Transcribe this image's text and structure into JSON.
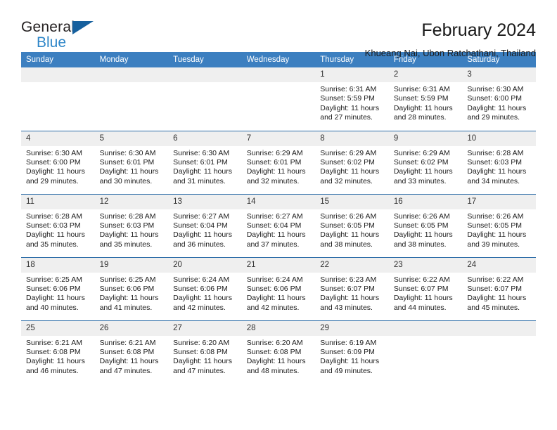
{
  "logo": {
    "word_top": "General",
    "word_bottom": "Blue",
    "triangle_color": "#16609E",
    "blue_color": "#2E86C8"
  },
  "header": {
    "title": "February 2024",
    "subtitle": "Khueang Nai, Ubon Ratchathani, Thailand"
  },
  "theme": {
    "header_blue": "#3C7FC0",
    "row_border_blue": "#2E6DA8",
    "daynum_gray": "#EFEFEF"
  },
  "weekdays": [
    "Sunday",
    "Monday",
    "Tuesday",
    "Wednesday",
    "Thursday",
    "Friday",
    "Saturday"
  ],
  "weeks": [
    [
      {
        "day": "",
        "lines": []
      },
      {
        "day": "",
        "lines": []
      },
      {
        "day": "",
        "lines": []
      },
      {
        "day": "",
        "lines": []
      },
      {
        "day": "1",
        "lines": [
          "Sunrise: 6:31 AM",
          "Sunset: 5:59 PM",
          "Daylight: 11 hours",
          "and 27 minutes."
        ]
      },
      {
        "day": "2",
        "lines": [
          "Sunrise: 6:31 AM",
          "Sunset: 5:59 PM",
          "Daylight: 11 hours",
          "and 28 minutes."
        ]
      },
      {
        "day": "3",
        "lines": [
          "Sunrise: 6:30 AM",
          "Sunset: 6:00 PM",
          "Daylight: 11 hours",
          "and 29 minutes."
        ]
      }
    ],
    [
      {
        "day": "4",
        "lines": [
          "Sunrise: 6:30 AM",
          "Sunset: 6:00 PM",
          "Daylight: 11 hours",
          "and 29 minutes."
        ]
      },
      {
        "day": "5",
        "lines": [
          "Sunrise: 6:30 AM",
          "Sunset: 6:01 PM",
          "Daylight: 11 hours",
          "and 30 minutes."
        ]
      },
      {
        "day": "6",
        "lines": [
          "Sunrise: 6:30 AM",
          "Sunset: 6:01 PM",
          "Daylight: 11 hours",
          "and 31 minutes."
        ]
      },
      {
        "day": "7",
        "lines": [
          "Sunrise: 6:29 AM",
          "Sunset: 6:01 PM",
          "Daylight: 11 hours",
          "and 32 minutes."
        ]
      },
      {
        "day": "8",
        "lines": [
          "Sunrise: 6:29 AM",
          "Sunset: 6:02 PM",
          "Daylight: 11 hours",
          "and 32 minutes."
        ]
      },
      {
        "day": "9",
        "lines": [
          "Sunrise: 6:29 AM",
          "Sunset: 6:02 PM",
          "Daylight: 11 hours",
          "and 33 minutes."
        ]
      },
      {
        "day": "10",
        "lines": [
          "Sunrise: 6:28 AM",
          "Sunset: 6:03 PM",
          "Daylight: 11 hours",
          "and 34 minutes."
        ]
      }
    ],
    [
      {
        "day": "11",
        "lines": [
          "Sunrise: 6:28 AM",
          "Sunset: 6:03 PM",
          "Daylight: 11 hours",
          "and 35 minutes."
        ]
      },
      {
        "day": "12",
        "lines": [
          "Sunrise: 6:28 AM",
          "Sunset: 6:03 PM",
          "Daylight: 11 hours",
          "and 35 minutes."
        ]
      },
      {
        "day": "13",
        "lines": [
          "Sunrise: 6:27 AM",
          "Sunset: 6:04 PM",
          "Daylight: 11 hours",
          "and 36 minutes."
        ]
      },
      {
        "day": "14",
        "lines": [
          "Sunrise: 6:27 AM",
          "Sunset: 6:04 PM",
          "Daylight: 11 hours",
          "and 37 minutes."
        ]
      },
      {
        "day": "15",
        "lines": [
          "Sunrise: 6:26 AM",
          "Sunset: 6:05 PM",
          "Daylight: 11 hours",
          "and 38 minutes."
        ]
      },
      {
        "day": "16",
        "lines": [
          "Sunrise: 6:26 AM",
          "Sunset: 6:05 PM",
          "Daylight: 11 hours",
          "and 38 minutes."
        ]
      },
      {
        "day": "17",
        "lines": [
          "Sunrise: 6:26 AM",
          "Sunset: 6:05 PM",
          "Daylight: 11 hours",
          "and 39 minutes."
        ]
      }
    ],
    [
      {
        "day": "18",
        "lines": [
          "Sunrise: 6:25 AM",
          "Sunset: 6:06 PM",
          "Daylight: 11 hours",
          "and 40 minutes."
        ]
      },
      {
        "day": "19",
        "lines": [
          "Sunrise: 6:25 AM",
          "Sunset: 6:06 PM",
          "Daylight: 11 hours",
          "and 41 minutes."
        ]
      },
      {
        "day": "20",
        "lines": [
          "Sunrise: 6:24 AM",
          "Sunset: 6:06 PM",
          "Daylight: 11 hours",
          "and 42 minutes."
        ]
      },
      {
        "day": "21",
        "lines": [
          "Sunrise: 6:24 AM",
          "Sunset: 6:06 PM",
          "Daylight: 11 hours",
          "and 42 minutes."
        ]
      },
      {
        "day": "22",
        "lines": [
          "Sunrise: 6:23 AM",
          "Sunset: 6:07 PM",
          "Daylight: 11 hours",
          "and 43 minutes."
        ]
      },
      {
        "day": "23",
        "lines": [
          "Sunrise: 6:22 AM",
          "Sunset: 6:07 PM",
          "Daylight: 11 hours",
          "and 44 minutes."
        ]
      },
      {
        "day": "24",
        "lines": [
          "Sunrise: 6:22 AM",
          "Sunset: 6:07 PM",
          "Daylight: 11 hours",
          "and 45 minutes."
        ]
      }
    ],
    [
      {
        "day": "25",
        "lines": [
          "Sunrise: 6:21 AM",
          "Sunset: 6:08 PM",
          "Daylight: 11 hours",
          "and 46 minutes."
        ]
      },
      {
        "day": "26",
        "lines": [
          "Sunrise: 6:21 AM",
          "Sunset: 6:08 PM",
          "Daylight: 11 hours",
          "and 47 minutes."
        ]
      },
      {
        "day": "27",
        "lines": [
          "Sunrise: 6:20 AM",
          "Sunset: 6:08 PM",
          "Daylight: 11 hours",
          "and 47 minutes."
        ]
      },
      {
        "day": "28",
        "lines": [
          "Sunrise: 6:20 AM",
          "Sunset: 6:08 PM",
          "Daylight: 11 hours",
          "and 48 minutes."
        ]
      },
      {
        "day": "29",
        "lines": [
          "Sunrise: 6:19 AM",
          "Sunset: 6:09 PM",
          "Daylight: 11 hours",
          "and 49 minutes."
        ]
      },
      {
        "day": "",
        "lines": []
      },
      {
        "day": "",
        "lines": []
      }
    ]
  ]
}
